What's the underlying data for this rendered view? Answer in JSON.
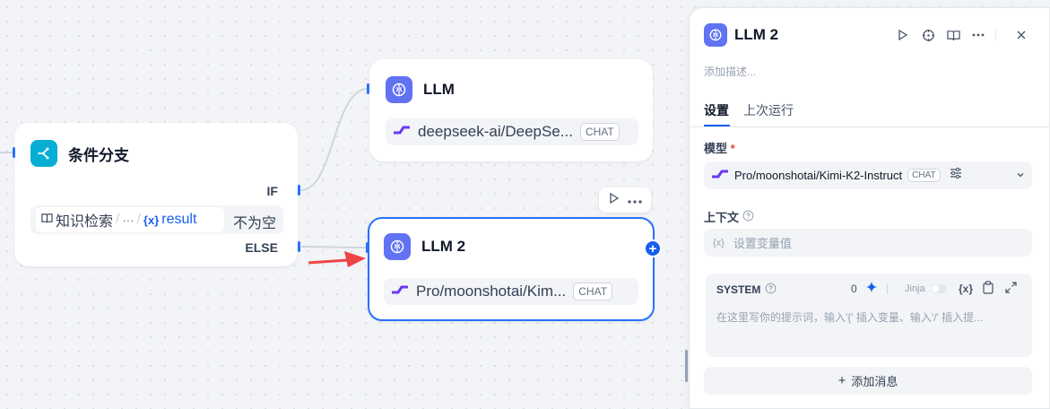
{
  "canvas": {
    "if_else_node": {
      "title": "条件分支",
      "icon": "branch-icon",
      "if_label": "IF",
      "else_label": "ELSE",
      "condition": {
        "var_icon": "book-icon",
        "var_source": "知识检索",
        "separator1": "/",
        "ellipsis": "···",
        "separator2": "/",
        "var_prefix": "{x}",
        "var_name": "result",
        "operator": "不为空"
      }
    },
    "llm_node": {
      "title": "LLM",
      "icon": "brain-icon",
      "model": "deepseek-ai/DeepSe...",
      "tag": "CHAT"
    },
    "llm2_node": {
      "title": "LLM 2",
      "icon": "brain-icon",
      "model": "Pro/moonshotai/Kim...",
      "tag": "CHAT",
      "add_symbol": "+"
    },
    "colors": {
      "accent": "#2970ff",
      "llm_icon_bg": "#6172f3",
      "if_icon_bg": "#06aed4",
      "arrow": "#ef4444"
    }
  },
  "panel": {
    "title": "LLM 2",
    "description_placeholder": "添加描述...",
    "tabs": [
      {
        "label": "设置",
        "active": true
      },
      {
        "label": "上次运行",
        "active": false
      }
    ],
    "model_section": {
      "label": "模型",
      "required": "*",
      "model": "Pro/moonshotai/Kimi-K2-Instruct",
      "tag": "CHAT"
    },
    "context_section": {
      "label": "上下文",
      "var_prefix": "{x}",
      "placeholder": "设置变量值"
    },
    "system_prompt": {
      "label": "SYSTEM",
      "token_count": "0",
      "jinja_label": "Jinja",
      "var_prefix": "{x}",
      "placeholder": "在这里写你的提示词，输入'{' 插入变量、输入'/' 插入提..."
    },
    "add_message": "添加消息",
    "add_symbol": "+"
  }
}
